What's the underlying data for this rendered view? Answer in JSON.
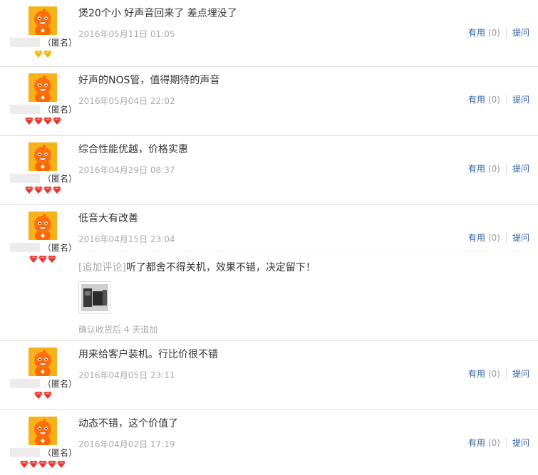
{
  "reviews": [
    {
      "text": "煲20个小 好声音回来了 差点埋没了",
      "date": "2016年05月11日 01:05",
      "user": "（匿名）",
      "badge_color": "#f2b600",
      "badge_count": 2,
      "useful_label": "有用",
      "useful_count": "(0)",
      "ask_label": "提问"
    },
    {
      "text": "好声的NOS管，值得期待的声音",
      "date": "2016年05月04日 22:02",
      "user": "（匿名）",
      "badge_color": "#e8322c",
      "badge_count": 4,
      "useful_label": "有用",
      "useful_count": "(0)",
      "ask_label": "提问"
    },
    {
      "text": "综合性能优越，价格实惠",
      "date": "2016年04月29日 08:37",
      "user": "（匿名）",
      "badge_color": "#e8322c",
      "badge_count": 4,
      "useful_label": "有用",
      "useful_count": "(0)",
      "ask_label": "提问"
    },
    {
      "text": "低音大有改善",
      "date": "2016年04月15日 23:04",
      "user": "（匿名）",
      "badge_color": "#e8322c",
      "badge_count": 3,
      "useful_label": "有用",
      "useful_count": "(0)",
      "ask_label": "提问",
      "append": {
        "tag": "[追加评论]",
        "text": "听了都舍不得关机，效果不错，决定留下！",
        "note": "确认收货后 4 天追加"
      }
    },
    {
      "text": "用来给客户装机。行比价很不错",
      "date": "2016年04月05日 23:11",
      "user": "（匿名）",
      "badge_color": "#e8322c",
      "badge_count": 2,
      "useful_label": "有用",
      "useful_count": "(0)",
      "ask_label": "提问"
    },
    {
      "text": "动态不错，这个价值了",
      "date": "2016年04月02日 17:19",
      "user": "（匿名）",
      "badge_color": "#e8322c",
      "badge_count": 5,
      "useful_label": "有用",
      "useful_count": "(0)",
      "ask_label": "提问"
    }
  ]
}
